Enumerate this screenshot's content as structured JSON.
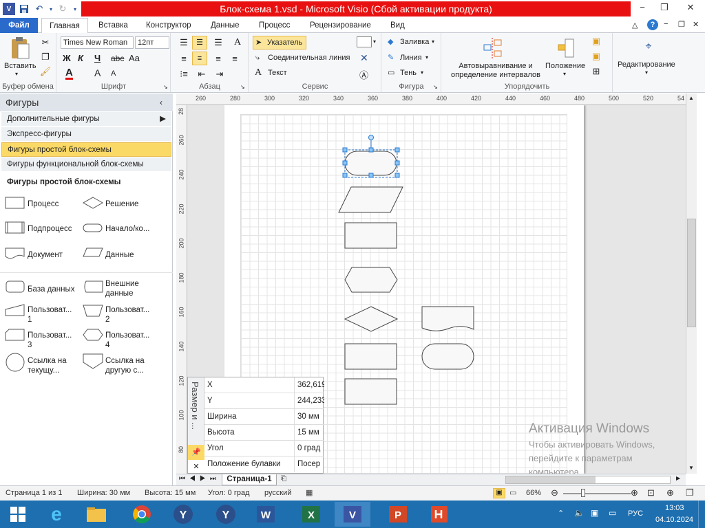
{
  "window": {
    "title": "Блок-схема 1.vsd - Microsoft Visio (Сбой активации продукта)",
    "minimize": "−",
    "restore": "❐",
    "close": "✕"
  },
  "tabs": {
    "file": "Файл",
    "items": [
      "Главная",
      "Вставка",
      "Конструктор",
      "Данные",
      "Процесс",
      "Рецензирование",
      "Вид"
    ]
  },
  "ribbon": {
    "clipboard": {
      "label": "Буфер обмена",
      "paste": "Вставить"
    },
    "font": {
      "label": "Шрифт",
      "font_name": "Times New Roman",
      "font_size": "12пт",
      "bold": "Ж",
      "italic": "К",
      "underline": "Ч",
      "strike": "abc",
      "case": "Aa",
      "color": "A",
      "grow": "A",
      "shrink": "A"
    },
    "paragraph": {
      "label": "Абзац"
    },
    "tools": {
      "label": "Сервис",
      "pointer": "Указатель",
      "connector": "Соединительная линия",
      "text": "Текст"
    },
    "shape": {
      "label": "Фигура",
      "fill": "Заливка",
      "line": "Линия",
      "shadow": "Тень"
    },
    "arrange": {
      "label": "Упорядочить",
      "auto_align": "Автовыравнивание и определение интервалов",
      "position": "Положение"
    },
    "editing": {
      "label": "Редактирование"
    }
  },
  "shapes_pane": {
    "title": "Фигуры",
    "items": [
      "Дополнительные фигуры",
      "Экспресс-фигуры",
      "Фигуры простой блок-схемы",
      "Фигуры функциональной блок-схемы"
    ],
    "stencil_title": "Фигуры простой блок-схемы",
    "stencil": [
      "Процесс",
      "Решение",
      "Подпроцесс",
      "Начало/ко...",
      "Документ",
      "Данные",
      "База данных",
      "Внешние данные",
      "Пользоват... 1",
      "Пользоват... 2",
      "Пользоват... 3",
      "Пользоват... 4",
      "Ссылка на текущу...",
      "Ссылка на другую с..."
    ]
  },
  "ruler": {
    "h": [
      "260",
      "280",
      "300",
      "320",
      "340",
      "360",
      "380",
      "400",
      "420",
      "440",
      "460",
      "480",
      "500",
      "520",
      "54"
    ],
    "v": [
      "28",
      "260",
      "240",
      "220",
      "200",
      "180",
      "160",
      "140",
      "120",
      "100",
      "80"
    ]
  },
  "size_window": {
    "title": "Размер и ...",
    "rows": [
      {
        "k": "X",
        "v": "362,619"
      },
      {
        "k": "Y",
        "v": "244,233"
      },
      {
        "k": "Ширина",
        "v": "30 мм"
      },
      {
        "k": "Высота",
        "v": "15 мм"
      },
      {
        "k": "Угол",
        "v": "0 град"
      },
      {
        "k": "Положение булавки",
        "v": "Посер"
      }
    ]
  },
  "page_tab": "Страница-1",
  "watermark": {
    "title": "Активация Windows",
    "line1": "Чтобы активировать Windows,",
    "line2": "перейдите к параметрам",
    "line3": "компьютера."
  },
  "status": {
    "page": "Страница 1 из 1",
    "width": "Ширина: 30 мм",
    "height": "Высота: 15 мм",
    "angle": "Угол: 0 град",
    "lang": "русский",
    "zoom": "66%"
  },
  "taskbar": {
    "lang": "РУС",
    "time": "13:03",
    "date": "04.10.2024"
  }
}
